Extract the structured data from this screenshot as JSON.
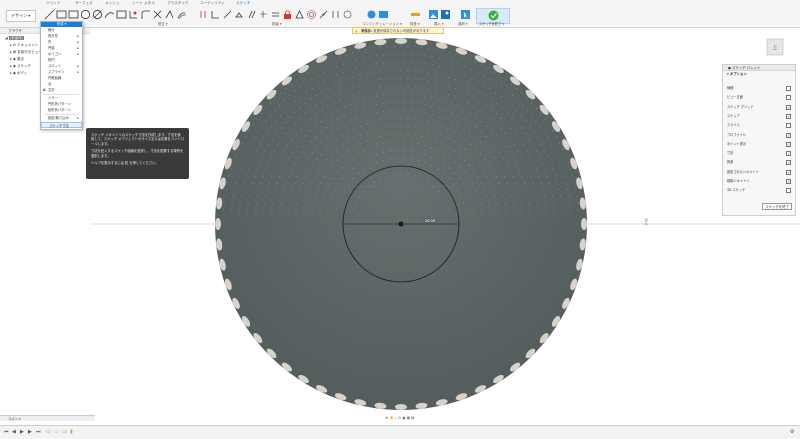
{
  "tabs": [
    "ソリッド",
    "サーフェス",
    "メッシュ",
    "シート メタル",
    "プラスチック",
    "ユーティリティ",
    "スケッチ"
  ],
  "active_tab": "スケッチ",
  "design_button": "デザイン",
  "ribbon_groups": {
    "create": "作成",
    "modify": "修正",
    "constraints": "拘束",
    "configure": "コンフィギュレーション",
    "inspect": "検査",
    "insert": "挿入",
    "select": "選択",
    "finish": "スケッチを終了"
  },
  "browser": {
    "title": "ブラウザ",
    "nodes": [
      "(未保存)",
      "ドキュメント",
      "名前付きビュー",
      "原点",
      "スケッチ",
      "ボディ"
    ]
  },
  "menu": {
    "title": "作成",
    "items": [
      {
        "label": "線分",
        "arrow": false
      },
      {
        "label": "長方形",
        "arrow": true
      },
      {
        "label": "円",
        "arrow": true
      },
      {
        "label": "円弧",
        "arrow": true
      },
      {
        "label": "ポリゴン",
        "arrow": true
      },
      {
        "label": "楕円",
        "arrow": false
      },
      {
        "label": "スロット",
        "arrow": true
      },
      {
        "label": "スプライン",
        "arrow": true
      },
      {
        "label": "円錐曲線",
        "arrow": false
      },
      {
        "label": "点",
        "arrow": false
      },
      {
        "label": "文字",
        "arrow": false
      },
      {
        "label": "ミラー",
        "arrow": false
      },
      {
        "label": "円形状パターン",
        "arrow": false
      },
      {
        "label": "矩形状パターン",
        "arrow": false
      },
      {
        "label": "投影/取り込み",
        "arrow": true
      },
      {
        "label": "スケッチ寸法",
        "arrow": false
      }
    ]
  },
  "tooltip": {
    "p1": "スケッチ ジオメトリのスケッチ寸法を作成します。寸法を使用して、スケッチ オブジェクトのサイズまたは位置をコントロールします。",
    "p2": "寸法を記入するスケッチ曲線を選択し、寸法を配置する場所を選択します。",
    "p3": "ヘルプを表示するには 粒 を押してください。"
  },
  "warning": "変更が保存されない可能性があります",
  "warning_prefix": "未保存:",
  "dimension_text": "20.00",
  "ruler_label": "20.0",
  "viewcube_label": "上",
  "palette": {
    "title": "スケッチ パレット",
    "section": "オプション",
    "rows": [
      {
        "label": "線種",
        "checked": false
      },
      {
        "label": "ビュー正面",
        "checked": false
      },
      {
        "label": "スケッチ グリッド",
        "checked": true
      },
      {
        "label": "スナップ",
        "checked": true
      },
      {
        "label": "スライス",
        "checked": false
      },
      {
        "label": "プロファイル",
        "checked": true
      },
      {
        "label": "ポイント表示",
        "checked": true
      },
      {
        "label": "寸法",
        "checked": true
      },
      {
        "label": "拘束",
        "checked": true
      },
      {
        "label": "投影されたジオメトリ",
        "checked": true
      },
      {
        "label": "構築ジオメトリ",
        "checked": true
      },
      {
        "label": "3D スケッチ",
        "checked": false
      }
    ],
    "finish_button": "スケッチを終了"
  },
  "comments_label": "コメント",
  "colors": {
    "accent": "#1a7fd8",
    "body": "#5c6666",
    "sketch_line": "#1a1a1a",
    "tooltip_bg": "#3a3a3a"
  }
}
